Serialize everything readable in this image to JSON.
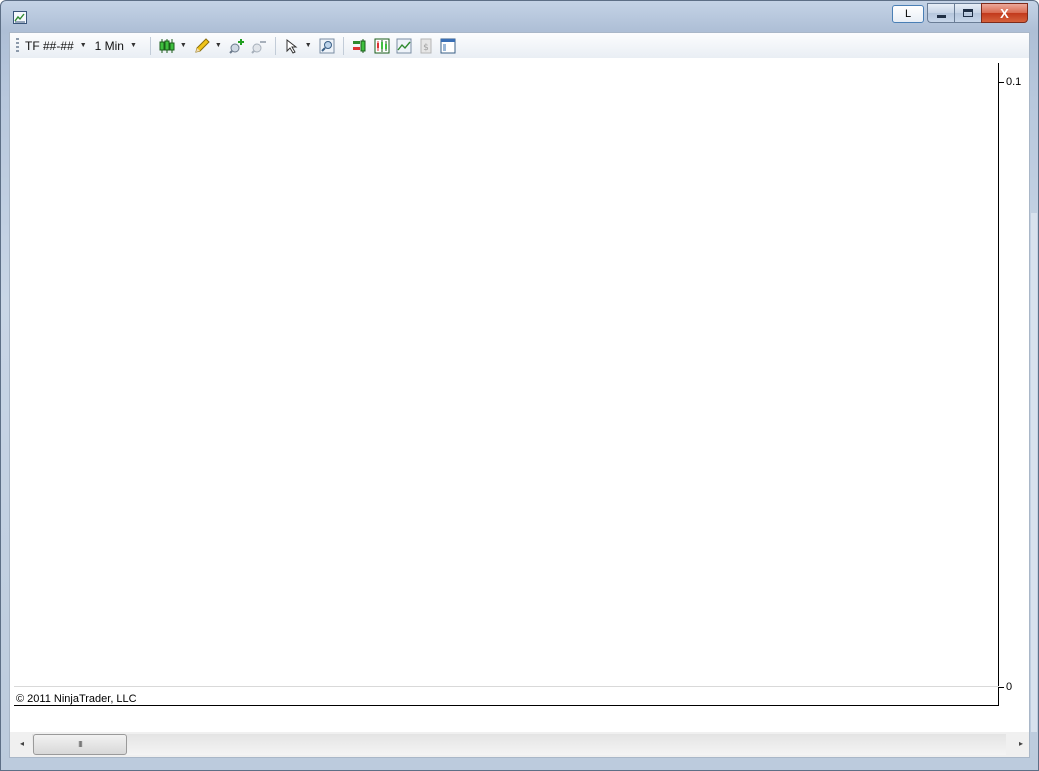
{
  "window": {
    "title": "",
    "l_button": "L",
    "close_glyph": "X"
  },
  "toolbar": {
    "instrument": "TF ##-##",
    "interval": "1 Min",
    "icons": [
      "candlestick-icon",
      "pencil-icon",
      "zoom-in-icon",
      "zoom-out-icon",
      "pointer-icon",
      "magnifier-icon",
      "orders-icon",
      "bar-chart-icon",
      "line-chart-icon",
      "dollar-icon",
      "properties-icon"
    ]
  },
  "chart": {
    "y_labels": [
      "0.1",
      "0"
    ],
    "copyright": "© 2011 NinjaTrader, LLC"
  },
  "scrollbar": {
    "left_arrow": "◂",
    "right_arrow": "▸",
    "thumb_grip": "III"
  },
  "colors": {
    "frame": "#b8c8dd",
    "close_button": "#c2391c",
    "chart_background": "#ffffff"
  }
}
